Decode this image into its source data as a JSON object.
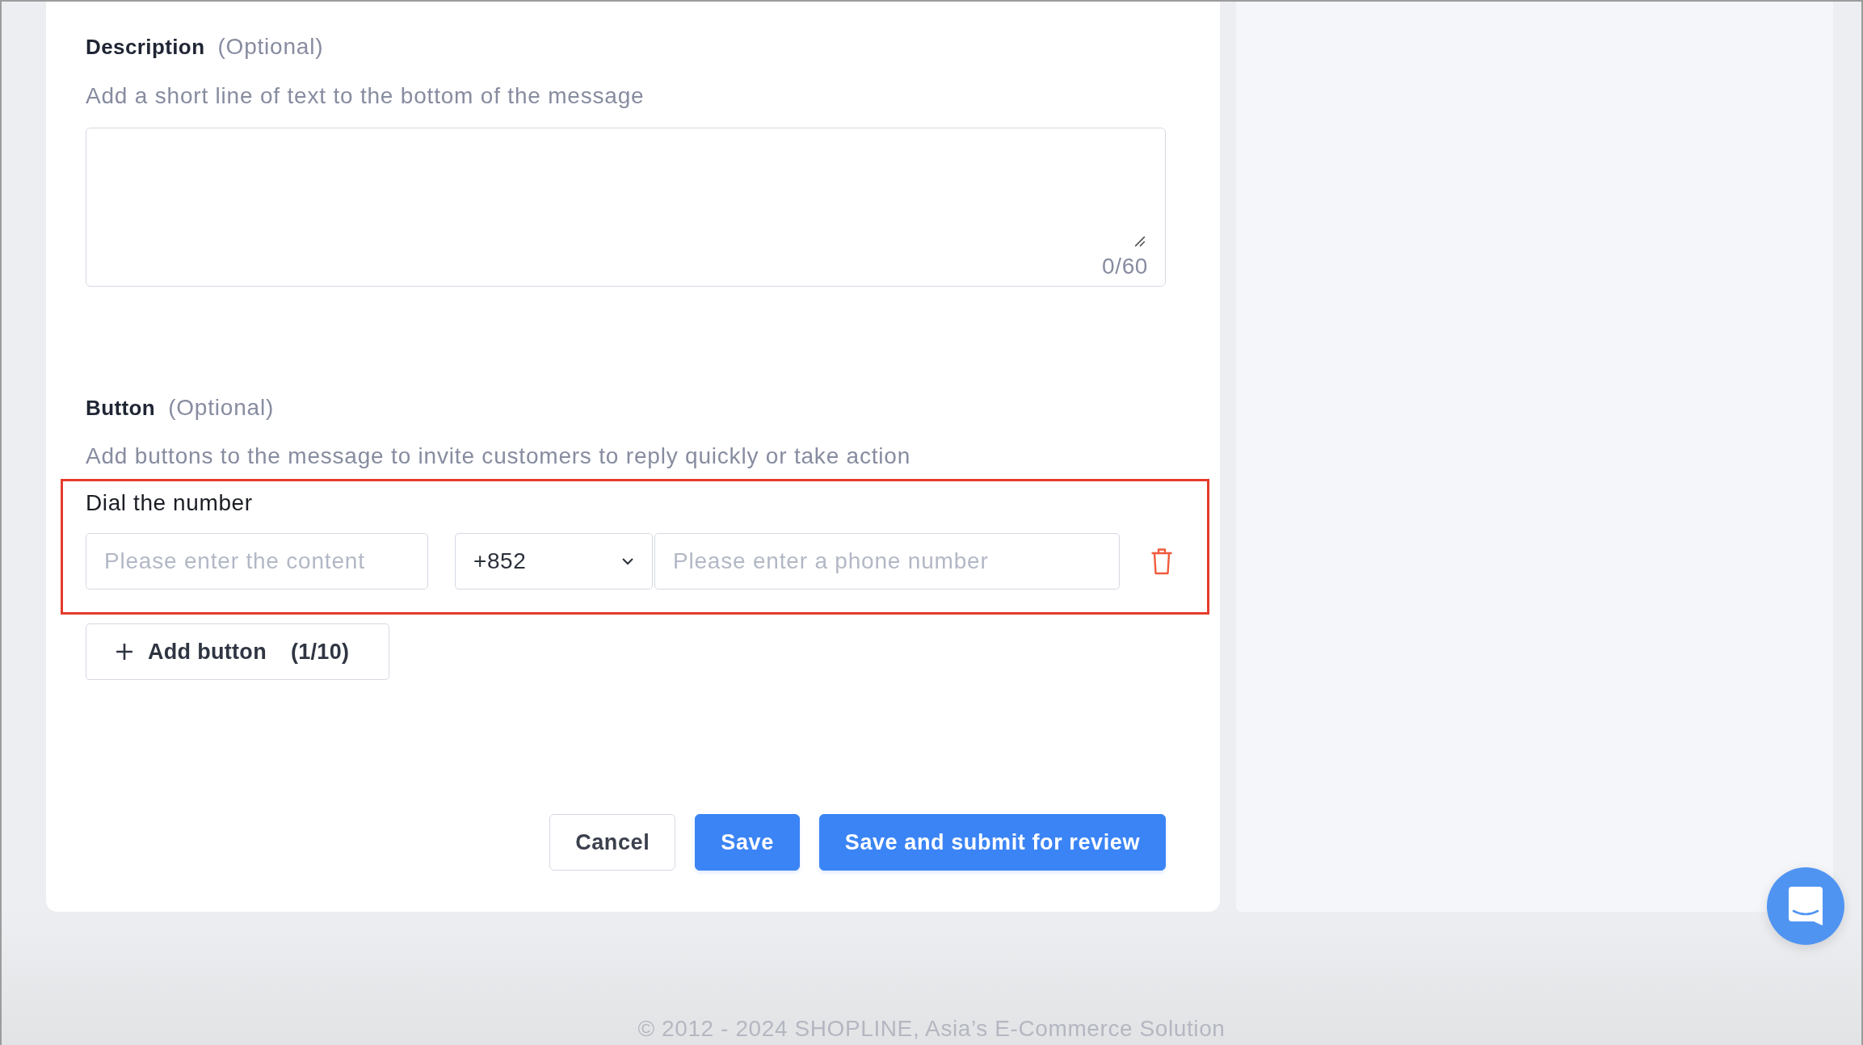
{
  "description": {
    "label": "Description",
    "optional_note": "(Optional)",
    "hint": "Add a short line of text to the bottom of the message",
    "counter": "0/60"
  },
  "button_section": {
    "label": "Button",
    "optional_note": "(Optional)",
    "hint": "Add buttons to the message to invite customers to reply quickly or take action",
    "highlighted": true,
    "buttons": [
      {
        "kind": "phone",
        "title": "Dial the number",
        "content": {
          "placeholder": "Please enter the content"
        },
        "country_code": "+852",
        "phone_number": {
          "placeholder": "Please enter a phone number"
        }
      }
    ],
    "add_button": {
      "label": "Add button",
      "count": "(1/10)"
    }
  },
  "actions": [
    {
      "label": "Cancel",
      "kind": "secondary"
    },
    {
      "label": "Save",
      "kind": "primary"
    },
    {
      "label": "Save and submit for review",
      "kind": "primary"
    }
  ],
  "footer": "© 2012 - 2024 SHOPLINE, Asia’s E-Commerce Solution"
}
